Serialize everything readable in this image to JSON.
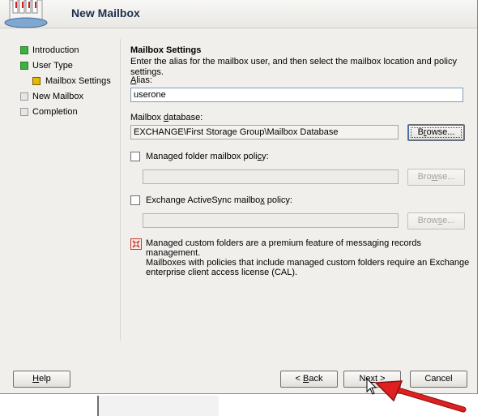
{
  "window": {
    "title": "New Mailbox"
  },
  "nav": {
    "items": [
      {
        "label": "Introduction",
        "state": "done"
      },
      {
        "label": "User Type",
        "state": "done"
      },
      {
        "label": "Mailbox Settings",
        "state": "current"
      },
      {
        "label": "New Mailbox",
        "state": "pending"
      },
      {
        "label": "Completion",
        "state": "pending"
      }
    ]
  },
  "main": {
    "title": "Mailbox Settings",
    "description": "Enter the alias for the mailbox user, and then select the mailbox location and policy settings.",
    "alias": {
      "label_pre": "",
      "label_accel": "A",
      "label_post": "lias:",
      "value": "userone"
    },
    "database": {
      "label_pre": "Mailbox ",
      "label_accel": "d",
      "label_post": "atabase:",
      "value": "EXCHANGE\\First Storage Group\\Mailbox Database",
      "browse_pre": "B",
      "browse_accel": "r",
      "browse_post": "owse..."
    },
    "managed_folder": {
      "label_pre": "Managed folder mailbox poli",
      "label_accel": "c",
      "label_post": "y:",
      "value": "",
      "browse_pre": "Bro",
      "browse_accel": "w",
      "browse_post": "se..."
    },
    "activesync": {
      "label_pre": "Exchange ActiveSync mailbo",
      "label_accel": "x",
      "label_post": " policy:",
      "value": "",
      "browse_pre": "Brow",
      "browse_accel": "s",
      "browse_post": "e..."
    },
    "info": {
      "line1": "Managed custom folders are a premium feature of messaging records management.",
      "line2": "Mailboxes with policies that include managed custom folders require an Exchange",
      "line3": "enterprise client access license (CAL)."
    }
  },
  "footer": {
    "help_accel": "H",
    "help_rest": "elp",
    "back_pre": "< ",
    "back_accel": "B",
    "back_rest": "ack",
    "next_pre": "Ne",
    "next_accel": "x",
    "next_rest": "t >",
    "cancel": "Cancel"
  },
  "colors": {
    "done": "#3db03d",
    "current": "#e6b800",
    "pending": "#e6e6e6",
    "arrow": "#e02020"
  }
}
